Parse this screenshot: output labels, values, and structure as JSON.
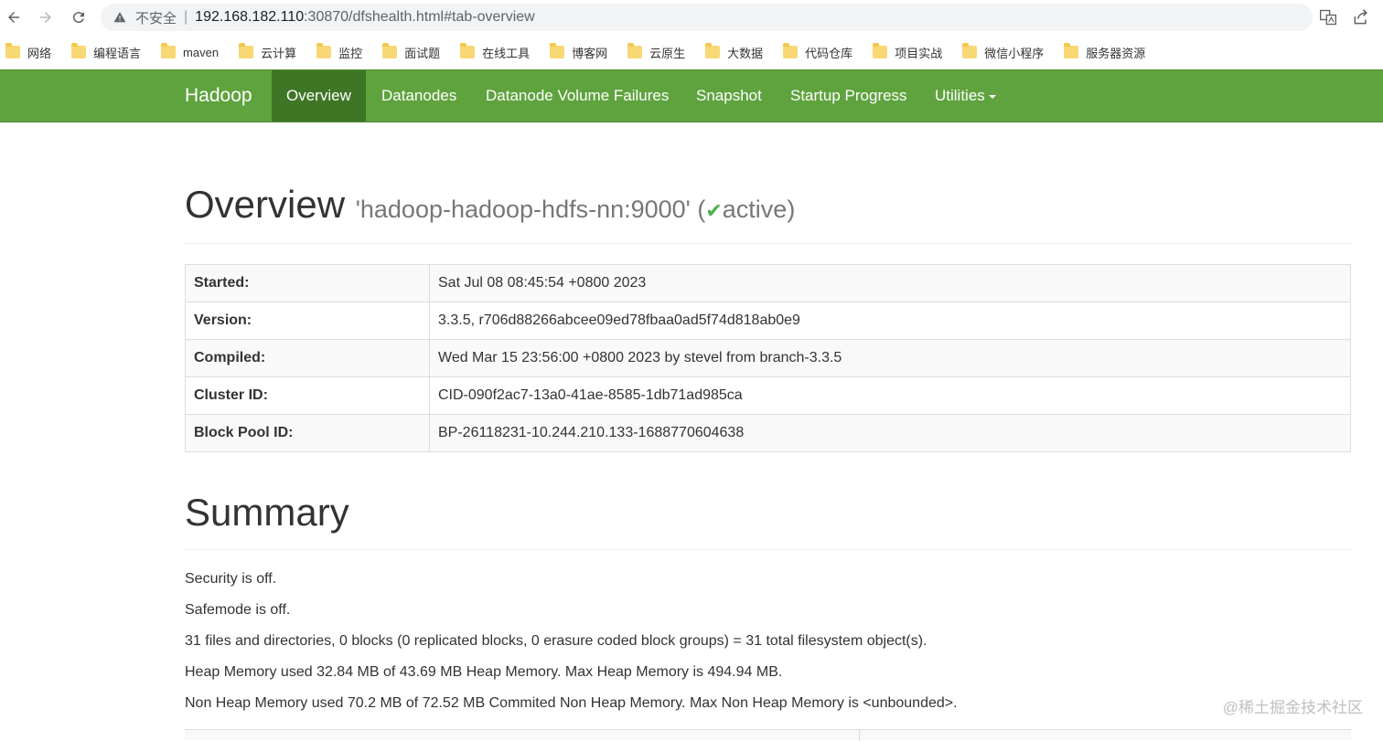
{
  "browser": {
    "insecure_label": "不安全",
    "url_host": "192.168.182.110",
    "url_rest": ":30870/dfshealth.html#tab-overview"
  },
  "bookmarks": [
    "网络",
    "编程语言",
    "maven",
    "云计算",
    "监控",
    "面试题",
    "在线工具",
    "博客网",
    "云原生",
    "大数据",
    "代码仓库",
    "项目实战",
    "微信小程序",
    "服务器资源"
  ],
  "navbar": {
    "brand": "Hadoop",
    "items": [
      "Overview",
      "Datanodes",
      "Datanode Volume Failures",
      "Snapshot",
      "Startup Progress",
      "Utilities"
    ],
    "active": "Overview",
    "color": "#5fa33e"
  },
  "overview": {
    "title": "Overview",
    "host": "'hadoop-hadoop-hdfs-nn:9000'",
    "open_paren": "(",
    "check": "✔",
    "state": "active",
    "close_paren": ")"
  },
  "info_rows": [
    {
      "key": "Started:",
      "value": "Sat Jul 08 08:45:54 +0800 2023"
    },
    {
      "key": "Version:",
      "value": "3.3.5, r706d88266abcee09ed78fbaa0ad5f74d818ab0e9"
    },
    {
      "key": "Compiled:",
      "value": "Wed Mar 15 23:56:00 +0800 2023 by stevel from branch-3.3.5"
    },
    {
      "key": "Cluster ID:",
      "value": "CID-090f2ac7-13a0-41ae-8585-1db71ad985ca"
    },
    {
      "key": "Block Pool ID:",
      "value": "BP-26118231-10.244.210.133-1688770604638"
    }
  ],
  "summary": {
    "title": "Summary",
    "lines": [
      "Security is off.",
      "Safemode is off.",
      "31 files and directories, 0 blocks (0 replicated blocks, 0 erasure coded block groups) = 31 total filesystem object(s).",
      "Heap Memory used 32.84 MB of 43.69 MB Heap Memory. Max Heap Memory is 494.94 MB.",
      "Non Heap Memory used 70.2 MB of 72.52 MB Commited Non Heap Memory. Max Non Heap Memory is <unbounded>."
    ]
  },
  "watermark": "@稀土掘金技术社区"
}
